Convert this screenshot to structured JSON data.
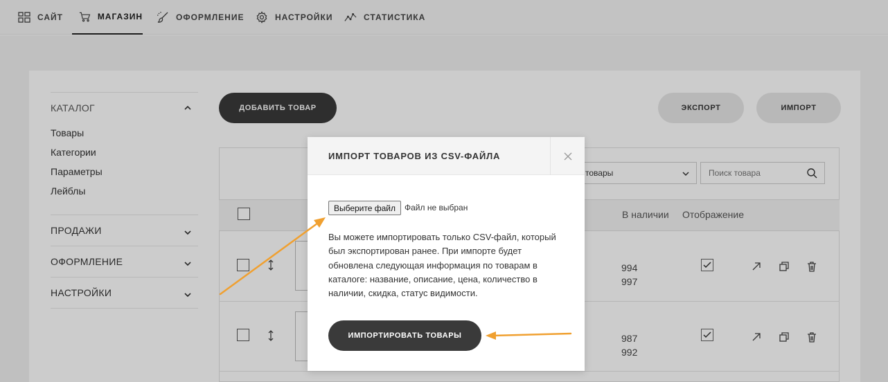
{
  "topnav": {
    "items": [
      {
        "label": "САЙТ",
        "icon": "grid-icon"
      },
      {
        "label": "МАГАЗИН",
        "icon": "cart-icon",
        "active": true
      },
      {
        "label": "ОФОРМЛЕНИЕ",
        "icon": "brush-icon"
      },
      {
        "label": "НАСТРОЙКИ",
        "icon": "gear-icon"
      },
      {
        "label": "СТАТИСТИКА",
        "icon": "chart-icon"
      }
    ]
  },
  "sidebar": {
    "catalog_label": "КАТАЛОГ",
    "catalog_items": [
      "Товары",
      "Категории",
      "Параметры",
      "Лейблы"
    ],
    "sections": [
      "ПРОДАЖИ",
      "ОФОРМЛЕНИЕ",
      "НАСТРОЙКИ"
    ]
  },
  "toolbar": {
    "add_product": "ДОБАВИТЬ ТОВАР",
    "export": "ЭКСПОРТ",
    "import": "ИМПОРТ"
  },
  "filters": {
    "select_value": "товары",
    "search_placeholder": "Поиск товара"
  },
  "table": {
    "headers": {
      "in_stock": "В наличии",
      "display": "Отображение"
    },
    "rows": [
      {
        "stock": [
          "994",
          "997"
        ],
        "visible": true
      },
      {
        "stock": [
          "987",
          "992"
        ],
        "visible": true
      }
    ]
  },
  "modal": {
    "title": "ИМПОРТ ТОВАРОВ ИЗ CSV-ФАЙЛА",
    "file_button": "Выберите файл",
    "file_status": "Файл не выбран",
    "description": "Вы можете импортировать только CSV-файл, который был экспортирован ранее. При импорте будет обновлена следующая информация по товарам в каталоге: название, описание, цена, количество в наличии, скидка, статус видимости.",
    "submit": "ИМПОРТИРОВАТЬ ТОВАРЫ"
  },
  "colors": {
    "dark_button": "#3a3a3a",
    "arrow": "#f0a030",
    "overlay": "rgba(0,0,0,0.2)"
  }
}
